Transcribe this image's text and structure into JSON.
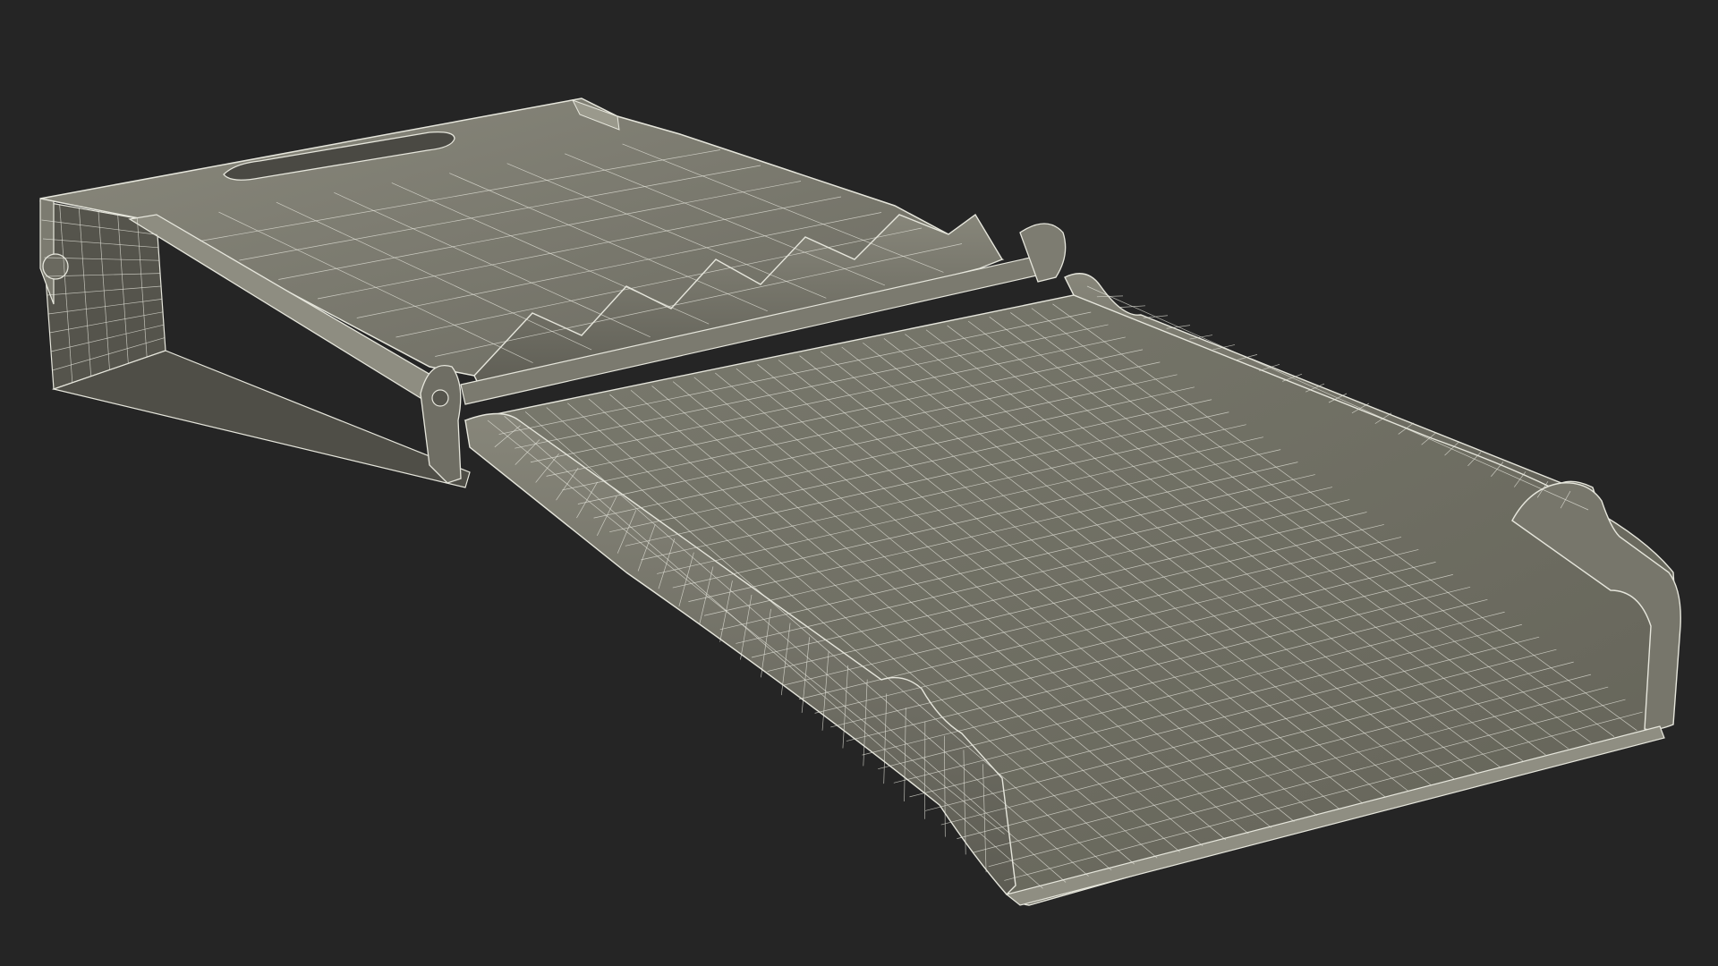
{
  "scene": {
    "background_color": "#252525",
    "surface_color": "#6e6d63",
    "surface_light_color": "#8d8c80",
    "surface_dark_color": "#56554d",
    "wire_color": "#e6e6dc"
  }
}
